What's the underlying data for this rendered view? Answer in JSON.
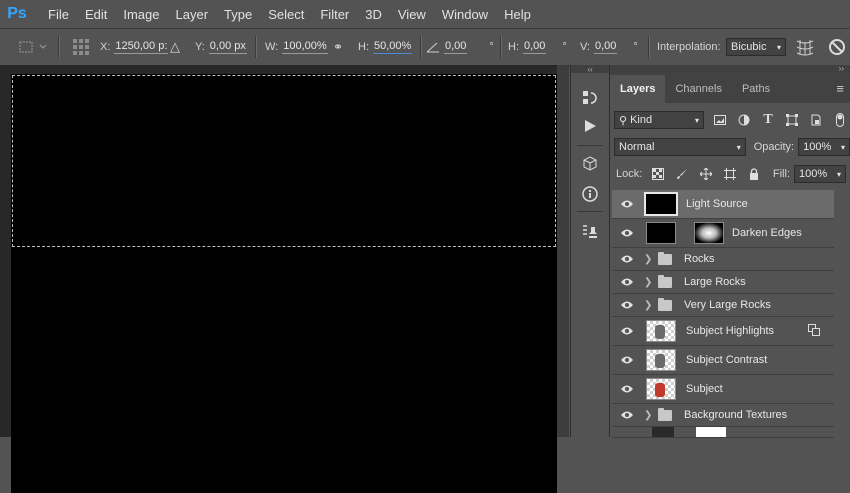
{
  "app": {
    "logo": "Ps"
  },
  "menu": [
    "File",
    "Edit",
    "Image",
    "Layer",
    "Type",
    "Select",
    "Filter",
    "3D",
    "View",
    "Window",
    "Help"
  ],
  "options": {
    "x_label": "X:",
    "x_value": "1250,00 p:",
    "y_label": "Y:",
    "y_value": "0,00 px",
    "w_label": "W:",
    "w_value": "100,00%",
    "h_label": "H:",
    "h_value": "50,00%",
    "angle_value": "0,00",
    "deg": "°",
    "hskew_label": "H:",
    "hskew_value": "0,00",
    "vskew_label": "V:",
    "vskew_value": "0,00",
    "interp_label": "Interpolation:",
    "interp_value": "Bicubic"
  },
  "layers_panel": {
    "tabs": [
      "Layers",
      "Channels",
      "Paths"
    ],
    "kind_label": "Kind",
    "blend_mode": "Normal",
    "opacity_label": "Opacity:",
    "opacity_value": "100%",
    "lock_label": "Lock:",
    "fill_label": "Fill:",
    "fill_value": "100%",
    "layers": [
      {
        "name": "Light Source",
        "type": "pixel",
        "selected": true
      },
      {
        "name": "Darken Edges",
        "type": "masked"
      },
      {
        "name": "Rocks",
        "type": "group"
      },
      {
        "name": "Large Rocks",
        "type": "group"
      },
      {
        "name": "Very Large Rocks",
        "type": "group"
      },
      {
        "name": "Subject Highlights",
        "type": "smart"
      },
      {
        "name": "Subject Contrast",
        "type": "smart"
      },
      {
        "name": "Subject",
        "type": "smart-red"
      },
      {
        "name": "Background Textures",
        "type": "group"
      }
    ]
  },
  "colors": {
    "accent": "#31a8ff",
    "selection": "#6b6b6b",
    "canvas": "#000000",
    "workspace": "#282828"
  }
}
